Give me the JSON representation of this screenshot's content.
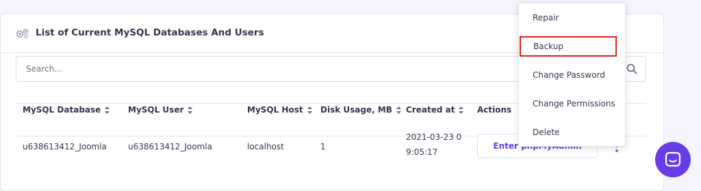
{
  "card": {
    "title": "List of Current MySQL Databases And Users",
    "icon": "gears-icon"
  },
  "search": {
    "placeholder": "Search...",
    "icon": "search-icon"
  },
  "table": {
    "columns": [
      {
        "label": "MySQL Database",
        "sortable": true
      },
      {
        "label": "MySQL User",
        "sortable": true
      },
      {
        "label": "MySQL Host",
        "sortable": true
      },
      {
        "label": "Disk Usage, MB",
        "sortable": true
      },
      {
        "label": "Created at",
        "sortable": true
      },
      {
        "label": "Actions",
        "sortable": false
      }
    ],
    "rows": [
      {
        "database": "u638613412_Joomla",
        "user": "u638613412_Joomla",
        "host": "localhost",
        "disk_usage": "1",
        "created_at": "2021-03-23 09:05:17",
        "action_label": "Enter phpMyAdmin"
      }
    ]
  },
  "menu": {
    "items": [
      {
        "label": "Repair"
      },
      {
        "label": "Backup",
        "highlighted": true
      },
      {
        "label": "Change Password"
      },
      {
        "label": "Change Permissions"
      },
      {
        "label": "Delete"
      }
    ]
  },
  "chat": {
    "icon": "chat-icon"
  },
  "colors": {
    "accent": "#673de6",
    "highlight_border": "#e11b1b",
    "text": "#36344d",
    "background": "#f4f5ff"
  }
}
